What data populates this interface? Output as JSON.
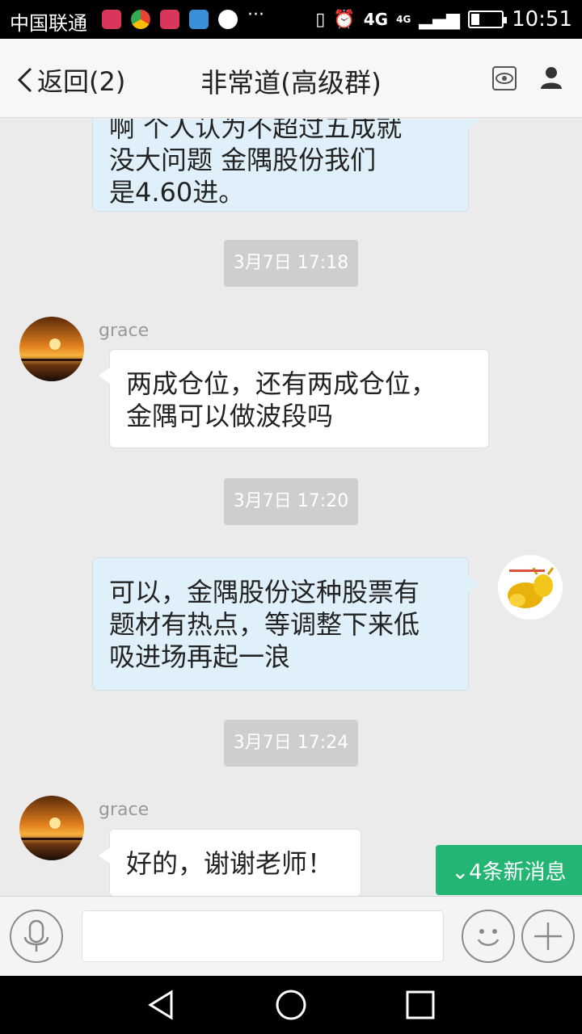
{
  "status_bar": {
    "carrier": "中国联通",
    "more": "···",
    "network": "4G",
    "network_small": "4G",
    "time": "10:51"
  },
  "nav": {
    "back_label": "返回(2)",
    "title": "非常道(高级群)"
  },
  "messages": [
    {
      "type": "outgoing",
      "lines": [
        "啊  个人认为不超过五成就",
        "没大问题      金隅股份我们",
        "是4.60进。"
      ]
    },
    {
      "type": "time",
      "text": "3月7日 17:18"
    },
    {
      "type": "incoming",
      "sender": "grace",
      "lines": [
        "两成仓位，还有两成仓位，",
        "金隅可以做波段吗"
      ]
    },
    {
      "type": "time",
      "text": "3月7日 17:20"
    },
    {
      "type": "outgoing",
      "lines": [
        "可以，金隅股份这种股票有",
        "题材有热点，等调整下来低",
        "吸进场再起一浪"
      ]
    },
    {
      "type": "time",
      "text": "3月7日 17:24"
    },
    {
      "type": "incoming",
      "sender": "grace",
      "lines": [
        "好的，谢谢老师！"
      ]
    }
  ],
  "new_messages_badge": "⌄4条新消息",
  "input": {
    "value": "",
    "placeholder": ""
  },
  "icons": {
    "voice": "microphone-icon",
    "emoji": "emoji-icon",
    "add": "plus-icon",
    "eye": "eye-icon",
    "profile": "person-icon"
  },
  "colors": {
    "outgoing_bubble": "#dff0fa",
    "incoming_bubble": "#ffffff",
    "badge": "#22b573",
    "chat_bg": "#ebebeb"
  }
}
